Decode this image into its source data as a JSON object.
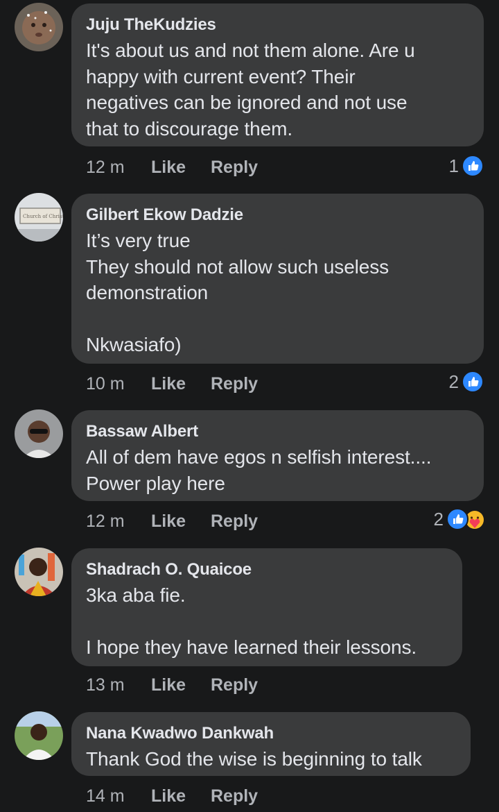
{
  "comments": [
    {
      "author": "Juju TheKudzies",
      "text": "It's about us and not them alone. Are u\nhappy with current event? Their\nnegatives can be ignored and not use\nthat to discourage them.",
      "time": "12 m",
      "like_label": "Like",
      "reply_label": "Reply",
      "reaction_count": "1",
      "reactions": [
        "like-icon"
      ]
    },
    {
      "author": "Gilbert Ekow Dadzie",
      "text": "It’s very true\nThey should not allow such useless\ndemonstration\n\nNkwasiafo)",
      "time": "10 m",
      "like_label": "Like",
      "reply_label": "Reply",
      "reaction_count": "2",
      "reactions": [
        "like-icon"
      ],
      "avatar_sign_text": "Church of Christ"
    },
    {
      "author": "Bassaw Albert",
      "text": "All of dem have egos n selfish interest....\nPower play here",
      "time": "12 m",
      "like_label": "Like",
      "reply_label": "Reply",
      "reaction_count": "2",
      "reactions": [
        "like-icon",
        "care-icon"
      ]
    },
    {
      "author": "Shadrach O. Quaicoe",
      "text": "3ka aba fie.\n\nI hope they have learned their lessons.",
      "time": "13 m",
      "like_label": "Like",
      "reply_label": "Reply",
      "reaction_count": "",
      "reactions": []
    },
    {
      "author": "Nana Kwadwo Dankwah",
      "text": "Thank God the wise is beginning to talk",
      "time": "14 m",
      "like_label": "Like",
      "reply_label": "Reply",
      "reaction_count": "",
      "reactions": []
    }
  ],
  "colors": {
    "background": "#18191a",
    "bubble": "#3a3b3c",
    "primary_text": "#e4e6eb",
    "secondary_text": "#b0b3b8",
    "like_blue": "#2d88ff"
  }
}
